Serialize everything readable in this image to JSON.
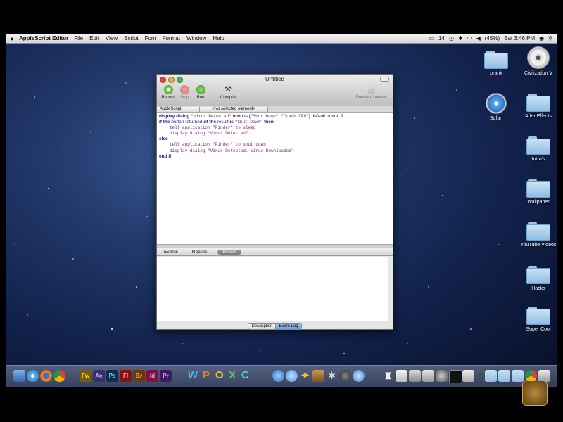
{
  "menubar": {
    "apple": "",
    "app_name": "AppleScript Editor",
    "items": [
      "File",
      "Edit",
      "View",
      "Script",
      "Font",
      "Format",
      "Window",
      "Help"
    ],
    "status": {
      "date_num": "14",
      "battery": "(45%)",
      "clock": "Sat 3:46 PM"
    }
  },
  "desktop_icons": [
    {
      "label": "prank"
    },
    {
      "label": "Civilization V"
    },
    {
      "label": "Safari"
    },
    {
      "label": "After Effects"
    },
    {
      "label": "Intro's"
    },
    {
      "label": "Wallpaper"
    },
    {
      "label": "YouTube Videos"
    },
    {
      "label": "Hacks"
    },
    {
      "label": "Super Cool"
    }
  ],
  "window": {
    "title": "Untitled",
    "toolbar": {
      "record": "Record",
      "stop": "Stop",
      "run": "Run",
      "compile": "Compile",
      "bundle": "Bundle Contents"
    },
    "nav": {
      "language": "AppleScript",
      "element": "<No selected element>"
    },
    "code": {
      "l1_kw": "display dialog",
      "l1_s1": "\"Virus Detected\"",
      "l1_kw2": "buttons",
      "l1_p1": "{",
      "l1_s2": "\"Shut Down\"",
      "l1_p2": ",",
      "l1_s3": "\"Crash CPU\"",
      "l1_p3": "}",
      "l1_kw3": "default button",
      "l1_num": "2",
      "l2_kw": "if the",
      "l2_a": "button returned",
      "l2_kw2": "of the",
      "l2_b": "result",
      "l2_kw3": "is",
      "l2_s": "\"Shut Down\"",
      "l2_kw4": "then",
      "l3": "tell application \"Finder\" to sleep",
      "l4": "display dialog \"Virus Detected\"",
      "l5": "else",
      "l6": "tell application \"Finder\" to shut down",
      "l7": "display dialog \"Virus Detected. Virus Downloaded\"",
      "l8": "end if"
    },
    "tabs": {
      "events": "Events",
      "replies": "Replies",
      "result": "Result"
    },
    "bottom": {
      "description": "Description",
      "event_log": "Event Log"
    }
  },
  "dock": {
    "apps": [
      "Fw",
      "Ae",
      "Ps",
      "Fl",
      "Br",
      "Id",
      "Pr"
    ],
    "letters": [
      "W",
      "P",
      "O",
      "X",
      "C"
    ]
  },
  "colors": {
    "accent": "#6f9ed4",
    "keyword": "#1a1aa0",
    "string": "#6a2b6a"
  }
}
